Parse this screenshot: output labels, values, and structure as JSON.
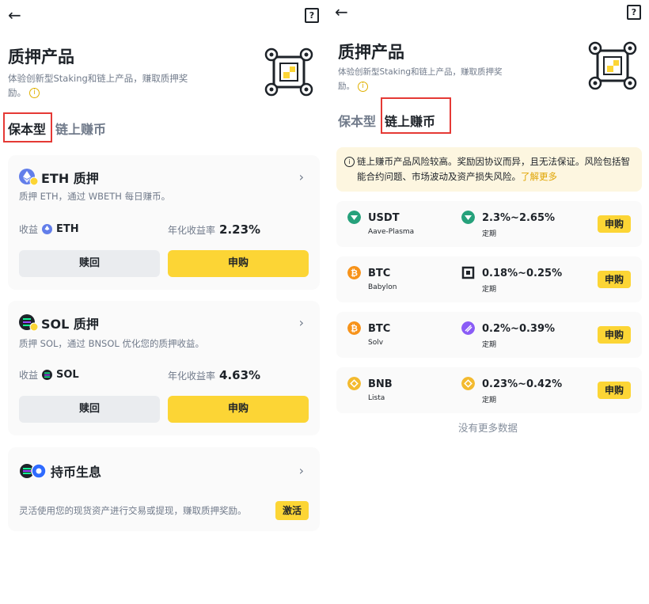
{
  "left": {
    "back_icon": "arrow-left-icon",
    "help_icon": "question-book-icon",
    "help_glyph": "?",
    "title": "质押产品",
    "desc_line1": "体验创新型Staking和链上产品，赚取质押奖",
    "desc_line2": "励。",
    "tabs": [
      "保本型",
      "链上赚币"
    ],
    "cards": [
      {
        "title": "ETH 质押",
        "desc": "质押 ETH，通过 WBETH 每日赚币。",
        "earn_label": "收益",
        "earn_coin": "ETH",
        "apr_label": "年化收益率",
        "apr": "2.23%",
        "redeem": "赎回",
        "subscribe": "申购"
      },
      {
        "title": "SOL 质押",
        "desc": "质押 SOL，通过 BNSOL 优化您的质押收益。",
        "earn_label": "收益",
        "earn_coin": "SOL",
        "apr_label": "年化收益率",
        "apr": "4.63%",
        "redeem": "赎回",
        "subscribe": "申购"
      }
    ],
    "flex": {
      "title": "持币生息",
      "desc": "灵活使用您的现货资产进行交易或提现，赚取质押奖励。",
      "button": "激活"
    },
    "colors": {
      "accent": "#fcd535",
      "eth": "#627eea",
      "sol_bg": "#1e2329"
    }
  },
  "right": {
    "title": "质押产品",
    "desc_line1": "体验创新型Staking和链上产品，赚取质押奖",
    "desc_line2": "励。",
    "tabs": [
      "保本型",
      "链上赚币"
    ],
    "notice": "链上赚币产品风险较高。奖励因协议而异，且无法保证。风险包括智能合约问题、市场波动及资产损失风险。",
    "notice_more": "了解更多",
    "products": [
      {
        "symbol": "USDT",
        "protocol": "Aave-Plasma",
        "rate": "2.3%~2.65%",
        "term": "定期",
        "button": "申购",
        "coin_color": "#26a17b",
        "protocol_color": "#26a17b"
      },
      {
        "symbol": "BTC",
        "protocol": "Babylon",
        "rate": "0.18%~0.25%",
        "term": "定期",
        "button": "申购",
        "coin_color": "#f7931a",
        "protocol_color": "#1e2329"
      },
      {
        "symbol": "BTC",
        "protocol": "Solv",
        "rate": "0.2%~0.39%",
        "term": "定期",
        "button": "申购",
        "coin_color": "#f7931a",
        "protocol_color": "#8a5cf6"
      },
      {
        "symbol": "BNB",
        "protocol": "Lista",
        "rate": "0.23%~0.42%",
        "term": "定期",
        "button": "申购",
        "coin_color": "#f3ba2f",
        "protocol_color": "#f3ba2f"
      }
    ],
    "no_more": "没有更多数据"
  }
}
